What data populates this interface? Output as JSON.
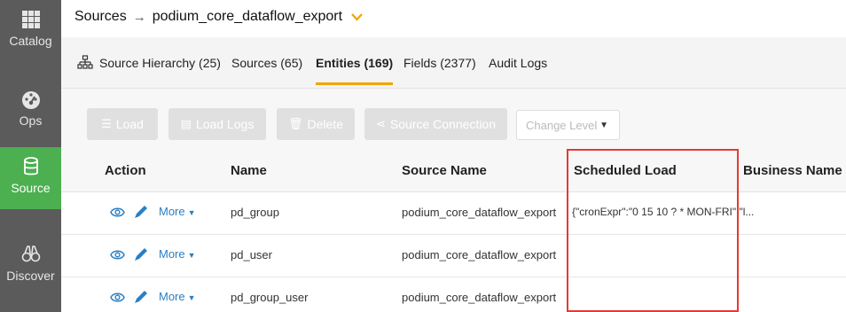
{
  "sidebar": {
    "items": [
      {
        "label": "Catalog",
        "icon": "grid-icon"
      },
      {
        "label": "Ops",
        "icon": "dashboard-gauge-icon"
      },
      {
        "label": "Source",
        "icon": "database-icon",
        "active": true
      },
      {
        "label": "Discover",
        "icon": "binoculars-icon"
      }
    ],
    "bg_color": "#5b5b5b",
    "active_color": "#4caf50"
  },
  "breadcrumb": {
    "root": "Sources",
    "separator": "→",
    "current": "podium_core_dataflow_export",
    "chevron": "⌄"
  },
  "tabs": [
    {
      "label": "Source Hierarchy (25)",
      "icon": "hierarchy-icon"
    },
    {
      "label": "Sources (65)"
    },
    {
      "label": "Entities (169)",
      "active": true
    },
    {
      "label": "Fields (2377)"
    },
    {
      "label": "Audit Logs"
    }
  ],
  "toolbar": {
    "load_label": "Load",
    "load_logs_label": "Load Logs",
    "delete_label": "Delete",
    "source_connection_label": "Source Connection",
    "change_level_placeholder": "Change Level"
  },
  "table": {
    "columns": [
      "Action",
      "Name",
      "Source Name",
      "Scheduled Load",
      "Business Name"
    ],
    "more_label": "More",
    "rows": [
      {
        "name": "pd_group",
        "source_name": "podium_core_dataflow_export",
        "scheduled_load": "{\"cronExpr\":\"0 15 10 ? * MON-FRI\",\"l..."
      },
      {
        "name": "pd_user",
        "source_name": "podium_core_dataflow_export",
        "scheduled_load": ""
      },
      {
        "name": "pd_group_user",
        "source_name": "podium_core_dataflow_export",
        "scheduled_load": ""
      }
    ]
  },
  "colors": {
    "accent": "#f0a500",
    "link": "#2a7fc4",
    "highlight_border": "#e53935"
  }
}
